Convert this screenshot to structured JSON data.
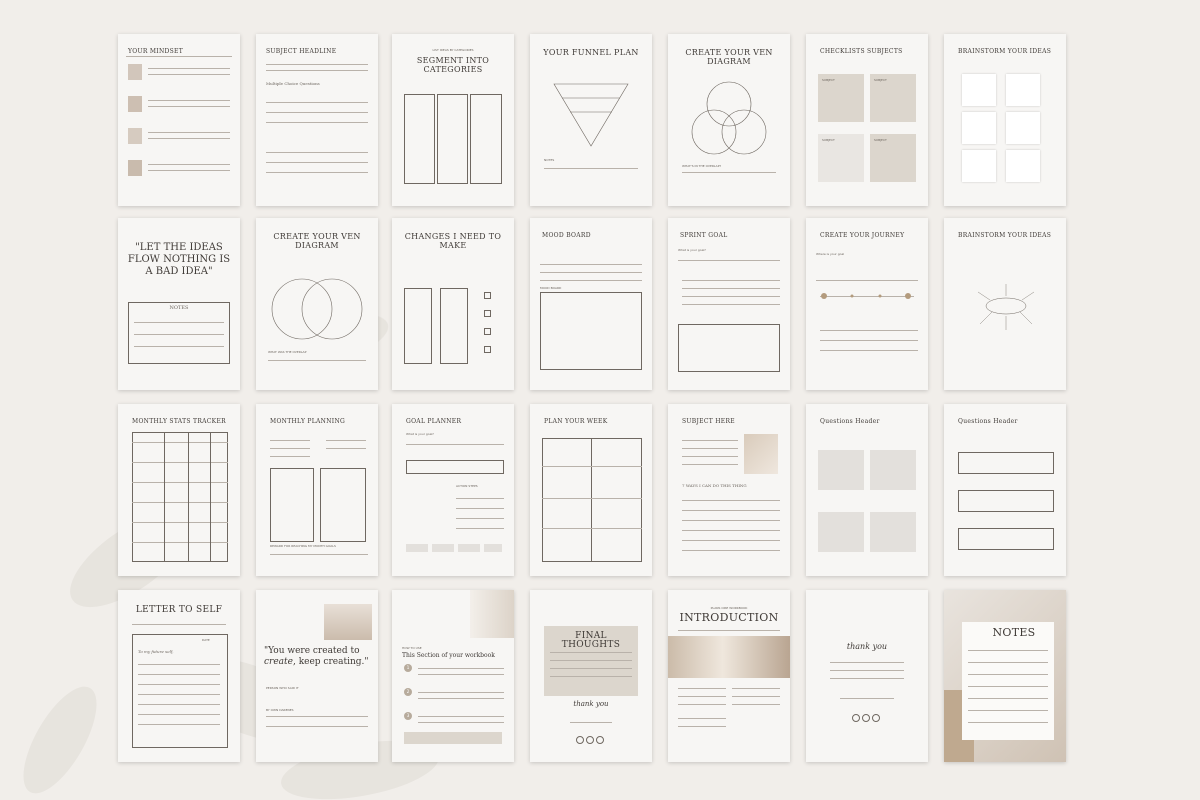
{
  "pages": {
    "p1": {
      "title": "YOUR MINDSET"
    },
    "p2": {
      "title": "SUBJECT HEADLINE",
      "sub": "Multiple Choice Questions"
    },
    "p3": {
      "kicker": "LIST IDEAS BY CATEGORIES",
      "title": "SEGMENT INTO CATEGORIES"
    },
    "p4": {
      "title": "YOUR FUNNEL PLAN",
      "note": "NOTES"
    },
    "p5": {
      "title": "CREATE YOUR VEN DIAGRAM",
      "note": "WHAT'S IN THE OVERLAP?"
    },
    "p6": {
      "title": "CHECKLISTS SUBJECTS",
      "subject": "SUBJECT"
    },
    "p7": {
      "title": "BRAINSTORM YOUR IDEAS"
    },
    "p8": {
      "quote": "\"LET THE IDEAS FLOW NOTHING IS A BAD IDEA\"",
      "notes": "NOTES"
    },
    "p9": {
      "title": "CREATE YOUR VEN DIAGRAM",
      "note": "WHAT WAS THE OVERLAP"
    },
    "p10": {
      "title": "CHANGES I NEED TO MAKE"
    },
    "p11": {
      "title": "MOOD BOARD",
      "sub": "MOOD BOARD"
    },
    "p12": {
      "title": "SPRINT GOAL",
      "q": "What is your goal?"
    },
    "p13": {
      "title": "CREATE YOUR JOURNEY",
      "q": "Where is your goal"
    },
    "p14": {
      "title": "BRAINSTORM YOUR IDEAS"
    },
    "p15": {
      "title": "MONTHLY STATS TRACKER"
    },
    "p16": {
      "title": "MONTHLY PLANNING",
      "note": "REWARD FOR REACHING MY MONTH GOALS"
    },
    "p17": {
      "title": "GOAL PLANNER",
      "q": "What is your goal?",
      "a": "ACTION STEPS"
    },
    "p18": {
      "title": "PLAN YOUR WEEK"
    },
    "p19": {
      "title": "SUBJECT HERE",
      "sub": "7 WAYS I CAN DO THIS THING"
    },
    "p20": {
      "title": "Questions Header"
    },
    "p21": {
      "title": "Questions Header"
    },
    "p22": {
      "title": "LETTER TO SELF",
      "salute": "To my future self,",
      "date": "DATE"
    },
    "p23": {
      "quote1": "\"You were created to ",
      "quote2": "create",
      "quote3": ", keep creating.\"",
      "author": "PERSON WHO SAID IT",
      "by": "BY OWN DARENES"
    },
    "p24": {
      "kicker": "HOW TO USE",
      "title": "This Section of your workbook",
      "steps": [
        "1",
        "2",
        "3"
      ]
    },
    "p25": {
      "title": "FINAL THOUGHTS",
      "sign": "thank you"
    },
    "p26": {
      "kicker": "PLANS CIRE WORKBOOK",
      "title": "INTRODUCTION"
    },
    "p27": {
      "sign": "thank you"
    },
    "p28": {
      "title": "NOTES"
    }
  },
  "colors": {
    "bg": "#f1eeea",
    "page": "#f7f6f4",
    "beige": "#dcd6cd",
    "ink": "#3f3a36"
  }
}
